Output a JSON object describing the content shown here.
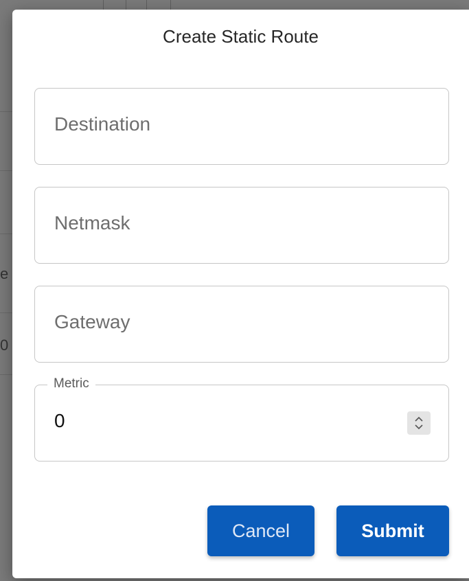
{
  "dialog": {
    "title": "Create Static Route"
  },
  "fields": {
    "destination": {
      "placeholder": "Destination"
    },
    "netmask": {
      "placeholder": "Netmask"
    },
    "gateway": {
      "placeholder": "Gateway"
    },
    "metric": {
      "label": "Metric",
      "value": "0"
    }
  },
  "icons": {
    "spinner": "up-down-chevron-icon"
  },
  "actions": {
    "cancel_label": "Cancel",
    "submit_label": "Submit"
  },
  "background": {
    "glyph_1": "e",
    "glyph_2": "0"
  },
  "colors": {
    "primary": "#0b5cba",
    "border": "#c6c6c6",
    "backdrop": "#7a7a7a"
  }
}
